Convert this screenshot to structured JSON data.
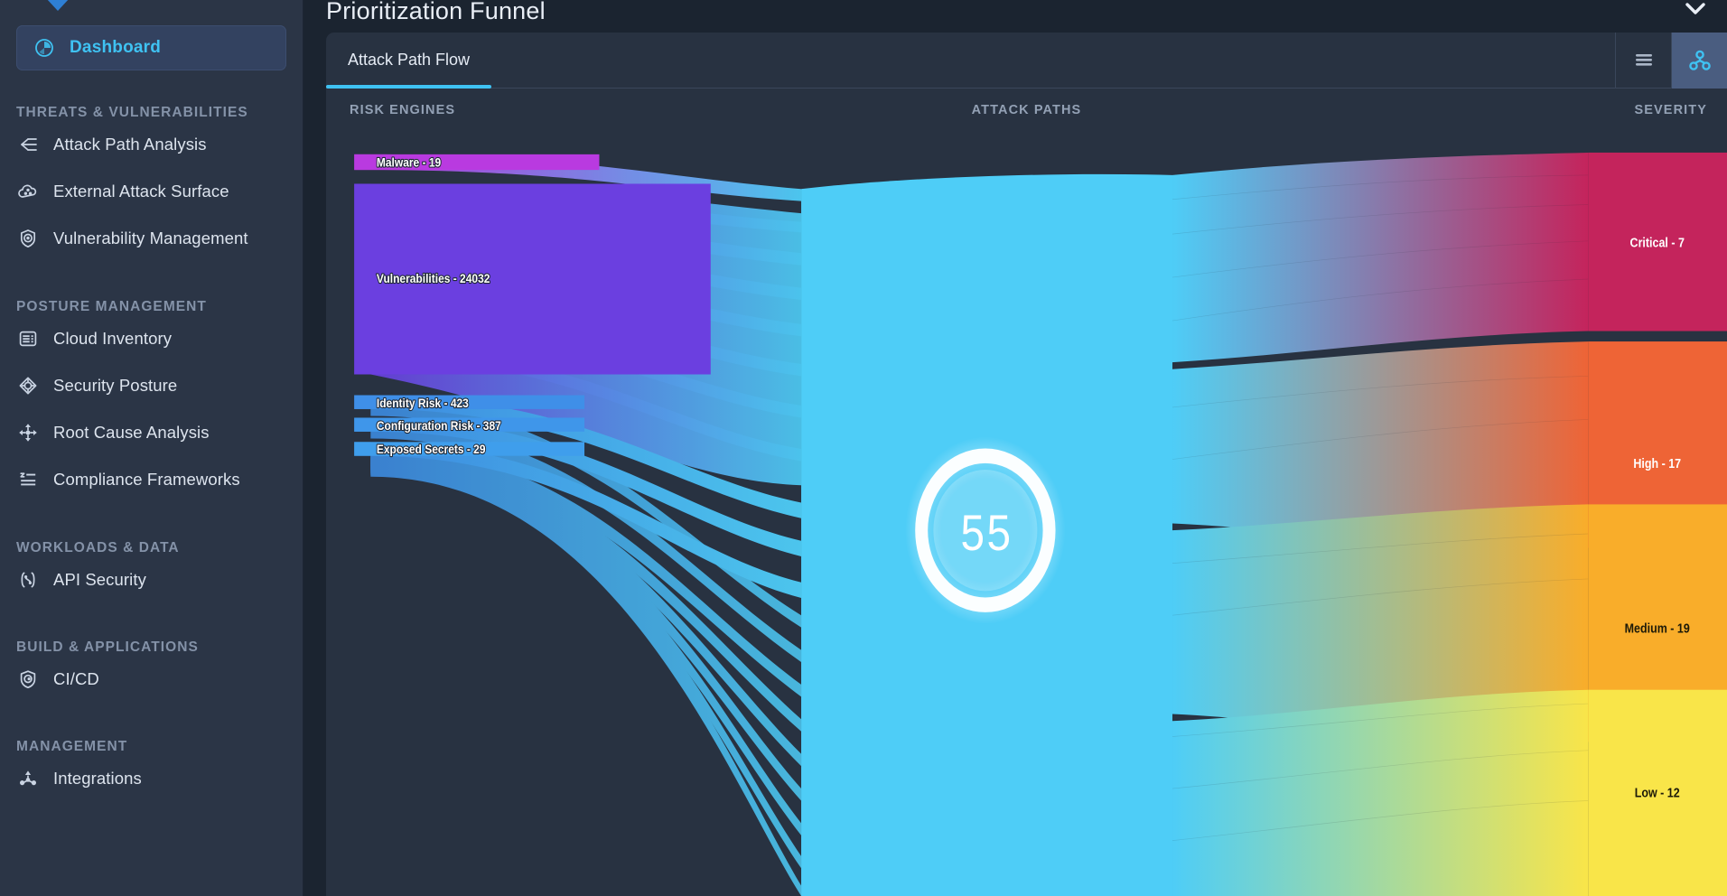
{
  "sidebar": {
    "active_item": {
      "label": "Dashboard",
      "icon": "clock-pie-icon"
    },
    "sections": [
      {
        "title": "THREATS & VULNERABILITIES",
        "items": [
          {
            "label": "Attack Path Analysis",
            "icon": "attack-path-icon"
          },
          {
            "label": "External Attack Surface",
            "icon": "cloud-surface-icon"
          },
          {
            "label": "Vulnerability Management",
            "icon": "shield-target-icon"
          }
        ]
      },
      {
        "title": "POSTURE MANAGEMENT",
        "items": [
          {
            "label": "Cloud Inventory",
            "icon": "inventory-list-icon"
          },
          {
            "label": "Security Posture",
            "icon": "posture-diamond-icon"
          },
          {
            "label": "Root Cause Analysis",
            "icon": "move-cross-icon"
          },
          {
            "label": "Compliance Frameworks",
            "icon": "compliance-list-icon"
          }
        ]
      },
      {
        "title": "WORKLOADS & DATA",
        "items": [
          {
            "label": "API Security",
            "icon": "api-brackets-icon"
          }
        ]
      },
      {
        "title": "BUILD & APPLICATIONS",
        "items": [
          {
            "label": "CI/CD",
            "icon": "cicd-shield-icon"
          }
        ]
      },
      {
        "title": "MANAGEMENT",
        "items": [
          {
            "label": "Integrations",
            "icon": "integrations-node-icon"
          }
        ]
      }
    ]
  },
  "header": {
    "title": "Prioritization Funnel",
    "collapse_icon": "chevron-down-icon"
  },
  "panel": {
    "tabs": [
      {
        "label": "Attack Path Flow",
        "active": true
      }
    ],
    "view_toggles": [
      {
        "icon": "list-view-icon",
        "active": false
      },
      {
        "icon": "node-graph-icon",
        "active": true
      }
    ],
    "column_headers": {
      "left": "RISK ENGINES",
      "middle": "ATTACK PATHS",
      "right": "SEVERITY"
    }
  },
  "colors": {
    "accent": "#3fc2f2",
    "sidebar_bg": "#2b3546",
    "panel_bg": "#283241",
    "page_bg": "#1b2430",
    "malware": "#b93ae0",
    "vulnerabilities": "#6b3fe0",
    "identity_risk": "#3f8fe8",
    "configuration_risk": "#3f96ea",
    "exposed_secrets": "#3f9eec",
    "attack_paths": "#4ecdf7",
    "critical": "#c4245c",
    "high": "#ee6436",
    "medium": "#f9ad2a",
    "low": "#f9e549"
  },
  "chart_data": {
    "type": "sankey",
    "title": "Prioritization Funnel",
    "stage_labels": [
      "RISK ENGINES",
      "ATTACK PATHS",
      "SEVERITY"
    ],
    "center_badge": "55",
    "sources": [
      {
        "name": "Malware",
        "value": 19,
        "label": "Malware - 19",
        "color": "#b93ae0"
      },
      {
        "name": "Vulnerabilities",
        "value": 24032,
        "label": "Vulnerabilities - 24032",
        "color": "#6b3fe0"
      },
      {
        "name": "Identity Risk",
        "value": 423,
        "label": "Identity Risk - 423",
        "color": "#3f8fe8"
      },
      {
        "name": "Configuration Risk",
        "value": 387,
        "label": "Configuration Risk - 387",
        "color": "#3f96ea"
      },
      {
        "name": "Exposed Secrets",
        "value": 29,
        "label": "Exposed Secrets - 29",
        "color": "#3f9eec"
      }
    ],
    "middle": {
      "name": "Attack Paths",
      "value": 55,
      "color": "#4ecdf7"
    },
    "targets": [
      {
        "name": "Critical",
        "value": 7,
        "label": "Critical - 7",
        "color": "#c4245c",
        "text": "light"
      },
      {
        "name": "High",
        "value": 17,
        "label": "High - 17",
        "color": "#ee6436",
        "text": "light"
      },
      {
        "name": "Medium",
        "value": 19,
        "label": "Medium - 19",
        "color": "#f9ad2a",
        "text": "dark"
      },
      {
        "name": "Low",
        "value": 12,
        "label": "Low - 12",
        "color": "#f9e549",
        "text": "dark"
      }
    ]
  }
}
